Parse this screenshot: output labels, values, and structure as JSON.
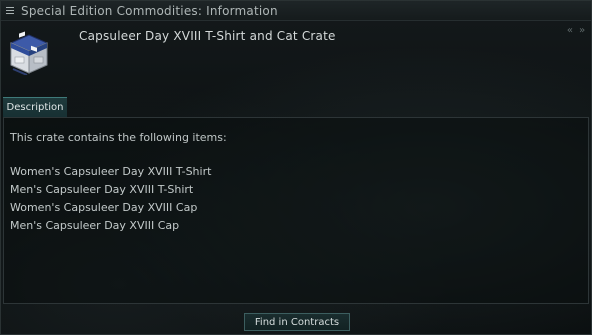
{
  "window": {
    "title": "Special Edition Commodities: Information"
  },
  "header": {
    "item_name": "Capsuleer Day XVIII T-Shirt and Cat Crate",
    "nav_back": "«",
    "nav_forward": "»",
    "icon": "crate-icon"
  },
  "tabs": [
    {
      "label": "Description"
    }
  ],
  "description": {
    "intro": "This crate contains the following items:",
    "items": [
      "Women's Capsuleer Day XVIII T-Shirt",
      "Men's Capsuleer Day XVIII T-Shirt",
      "Women's Capsuleer Day XVIII Cap",
      "Men's Capsuleer Day XVIII Cap"
    ]
  },
  "footer": {
    "find_button": "Find in Contracts"
  },
  "colors": {
    "accent": "#3f7a7a",
    "tab_bg": "#1f3a3c",
    "window_bg": "#0b0f10"
  }
}
